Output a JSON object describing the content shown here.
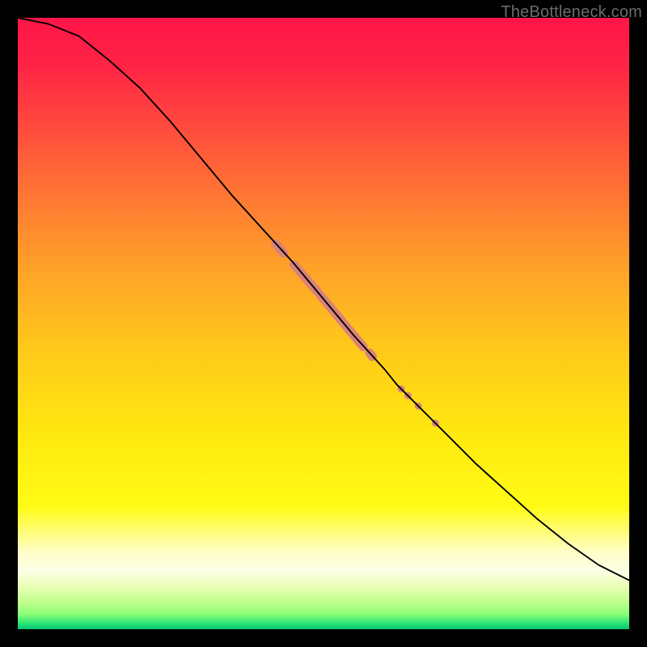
{
  "watermark": "TheBottleneck.com",
  "chart_data": {
    "type": "line",
    "title": "",
    "xlabel": "",
    "ylabel": "",
    "xlim": [
      0,
      100
    ],
    "ylim": [
      0,
      100
    ],
    "curve": {
      "x": [
        0,
        5,
        10,
        15,
        20,
        25,
        30,
        35,
        40,
        45,
        50,
        55,
        60,
        62,
        65,
        70,
        75,
        80,
        85,
        90,
        95,
        100
      ],
      "y": [
        100,
        99,
        97,
        93,
        88.5,
        83,
        77,
        71,
        65.5,
        60,
        54,
        48,
        42.5,
        40,
        37,
        32,
        27,
        22.5,
        18,
        14,
        10.5,
        8
      ]
    },
    "marker_segments": [
      {
        "x0": 42.2,
        "y0": 63.0,
        "x1": 43.5,
        "y1": 61.5,
        "r": 5.5
      },
      {
        "x0": 45.2,
        "y0": 59.6,
        "x1": 49.0,
        "y1": 55.2,
        "r": 5.5
      },
      {
        "x0": 49.5,
        "y0": 54.6,
        "x1": 56.5,
        "y1": 46.2,
        "r": 5.5
      },
      {
        "x0": 57.5,
        "y0": 45.2,
        "x1": 58.0,
        "y1": 44.6,
        "r": 5.5
      }
    ],
    "marker_points": [
      {
        "x": 62.7,
        "y": 39.3,
        "r": 4.5
      },
      {
        "x": 63.8,
        "y": 38.2,
        "r": 4.5
      },
      {
        "x": 65.5,
        "y": 36.5,
        "r": 4.5
      },
      {
        "x": 68.3,
        "y": 33.7,
        "r": 4.5
      }
    ],
    "gradient_stops": [
      {
        "pos": 0.0,
        "color": "#ff1548"
      },
      {
        "pos": 0.08,
        "color": "#ff2445"
      },
      {
        "pos": 0.18,
        "color": "#ff4b3d"
      },
      {
        "pos": 0.3,
        "color": "#ff7a33"
      },
      {
        "pos": 0.42,
        "color": "#ffa527"
      },
      {
        "pos": 0.55,
        "color": "#ffcb1a"
      },
      {
        "pos": 0.68,
        "color": "#ffe80f"
      },
      {
        "pos": 0.8,
        "color": "#fffb15"
      },
      {
        "pos": 0.875,
        "color": "#fffecb"
      },
      {
        "pos": 0.905,
        "color": "#fcffe6"
      },
      {
        "pos": 0.93,
        "color": "#e9ffb5"
      },
      {
        "pos": 0.955,
        "color": "#c3ff8e"
      },
      {
        "pos": 0.975,
        "color": "#8dff78"
      },
      {
        "pos": 0.99,
        "color": "#2fe576"
      },
      {
        "pos": 1.0,
        "color": "#00c774"
      }
    ],
    "marker_color": "#d68080",
    "curve_color": "#000000"
  }
}
